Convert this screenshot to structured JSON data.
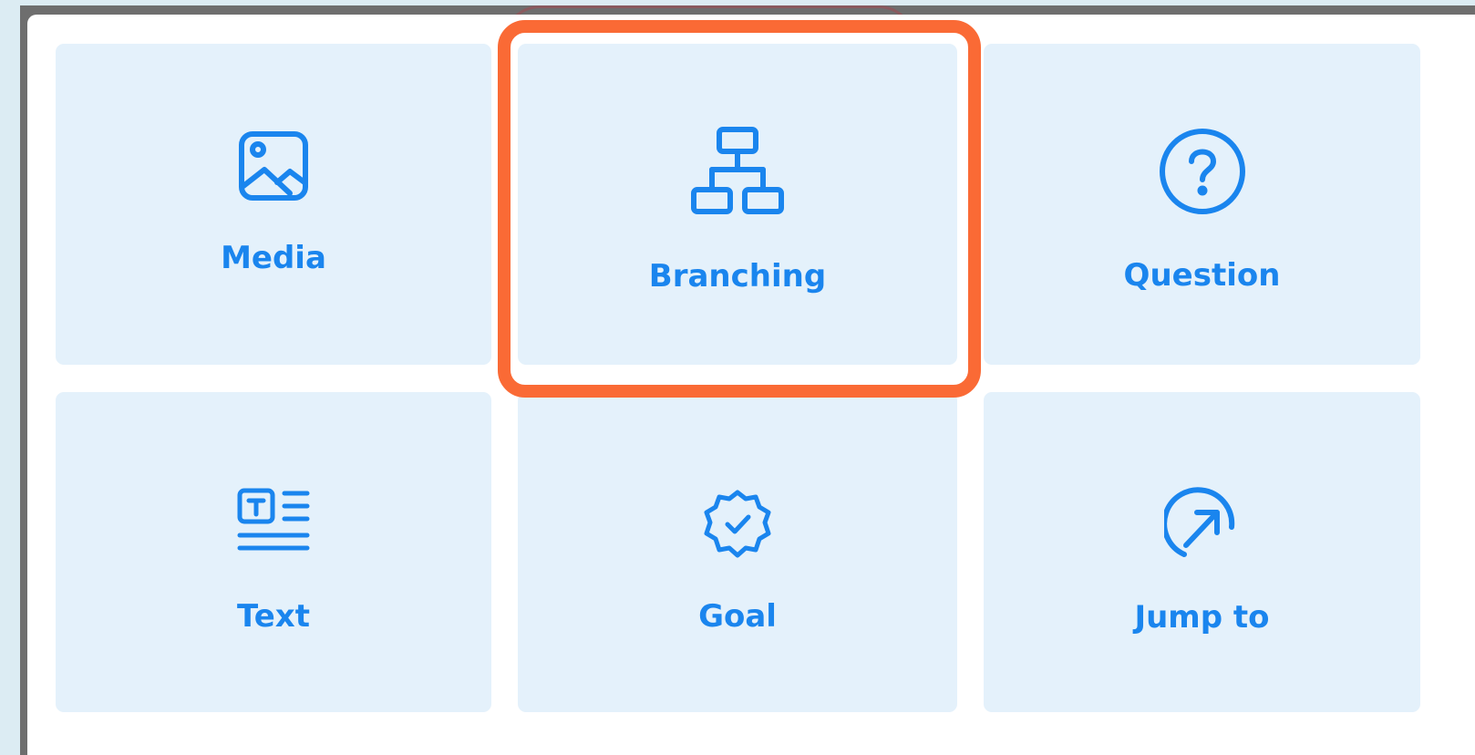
{
  "palette": {
    "accent": "#1a85ee",
    "tile_background": "#e4f1fb",
    "highlight": "#fa6a35",
    "panel": "#ffffff"
  },
  "tiles": [
    {
      "label": "Media",
      "icon": "image-icon"
    },
    {
      "label": "Branching",
      "icon": "hierarchy-icon",
      "highlighted": true
    },
    {
      "label": "Question",
      "icon": "question-circle-icon"
    },
    {
      "label": "Text",
      "icon": "text-block-icon"
    },
    {
      "label": "Goal",
      "icon": "badge-check-icon"
    },
    {
      "label": "Jump to",
      "icon": "arrow-up-right-circle-icon"
    }
  ]
}
